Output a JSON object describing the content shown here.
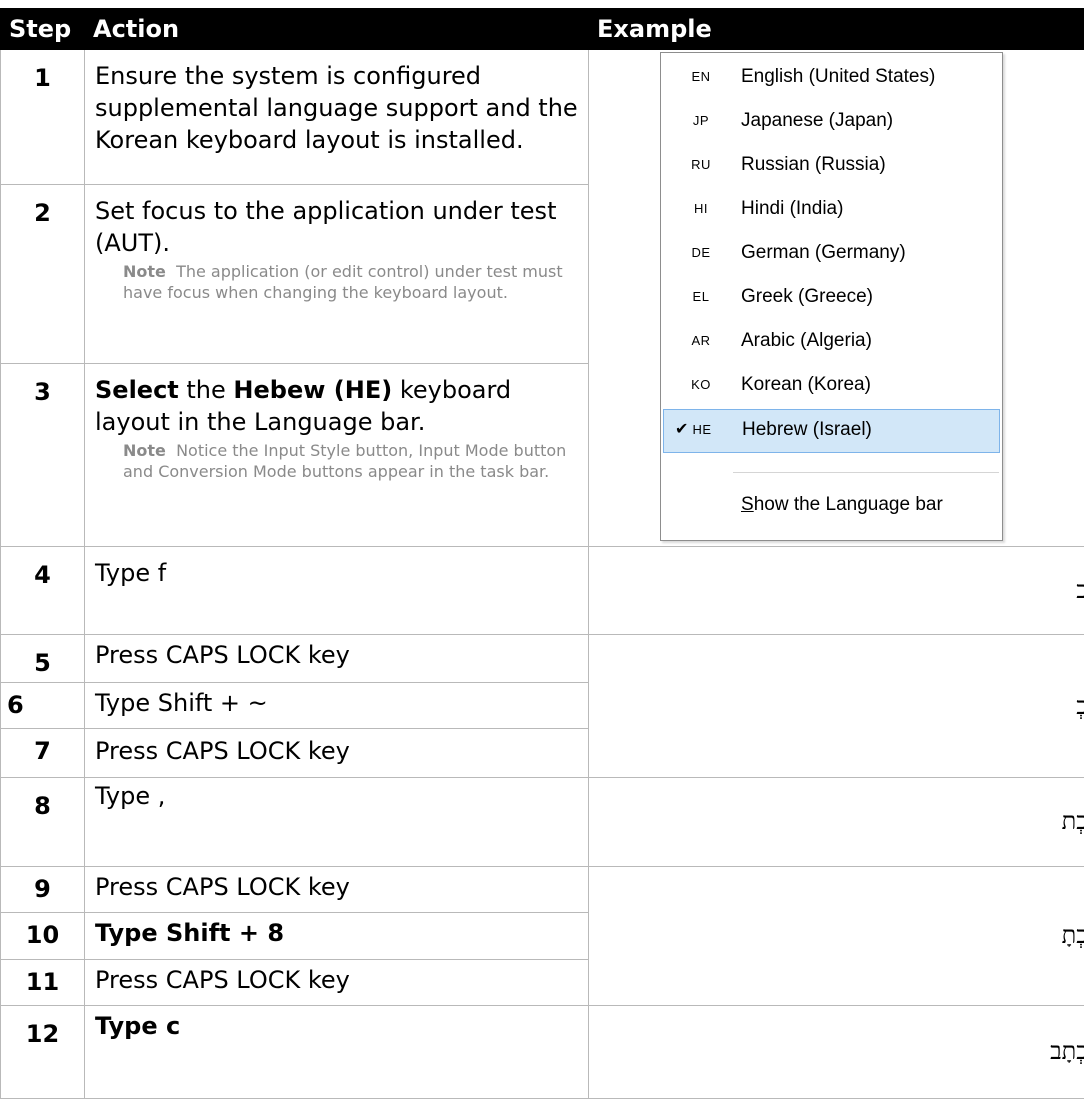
{
  "headers": {
    "step": "Step",
    "action": "Action",
    "example": "Example"
  },
  "rows": [
    {
      "step": "1",
      "action": "Ensure the system is configured supplemental language support and the Korean keyboard layout is installed."
    },
    {
      "step": "2",
      "action": "Set focus to the application under test (AUT).",
      "note_label": "Note",
      "note": "The application (or edit control) under test must have focus when changing the keyboard layout."
    },
    {
      "step": "3",
      "action_bold1": "Select",
      "action_mid": " the ",
      "action_bold2": "Hebew (HE)",
      "action_end": " keyboard layout in the Language bar.",
      "note_label": "Note",
      "note": "Notice the Input Style button, Input Mode button and Conversion Mode buttons appear in the task bar."
    },
    {
      "step": "4",
      "action": "Type f"
    },
    {
      "step": "5",
      "action": "Press CAPS LOCK key"
    },
    {
      "step": "6",
      "action": "Type Shift + ~"
    },
    {
      "step": "7",
      "action": "Press CAPS LOCK key"
    },
    {
      "step": "8",
      "action": "Type ,"
    },
    {
      "step": "9",
      "action": "Press CAPS LOCK key"
    },
    {
      "step": "10",
      "action": "Type Shift + 8"
    },
    {
      "step": "11",
      "action": "Press CAPS LOCK key"
    },
    {
      "step": "12",
      "action": "Type c"
    }
  ],
  "examples": {
    "row4": "כ",
    "row5to7": "כְ",
    "row8": "כְת",
    "row9to11": "כְתָ",
    "row12": "כְתָב"
  },
  "language_menu": {
    "items": [
      {
        "code": "EN",
        "name": "English (United States)"
      },
      {
        "code": "JP",
        "name": "Japanese (Japan)"
      },
      {
        "code": "RU",
        "name": "Russian (Russia)"
      },
      {
        "code": "HI",
        "name": "Hindi (India)"
      },
      {
        "code": "DE",
        "name": "German (Germany)"
      },
      {
        "code": "EL",
        "name": "Greek (Greece)"
      },
      {
        "code": "AR",
        "name": "Arabic (Algeria)"
      },
      {
        "code": "KO",
        "name": "Korean (Korea)"
      },
      {
        "code": "HE",
        "name": "Hebrew (Israel)",
        "selected": true,
        "check": "✔"
      }
    ],
    "show_bar_accel": "S",
    "show_bar_rest": "how the Language bar"
  }
}
